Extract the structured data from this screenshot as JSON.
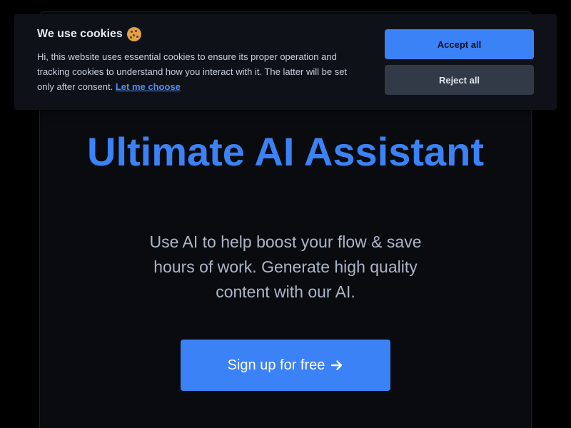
{
  "colors": {
    "background": "#000000",
    "card": "#0a0b0f",
    "accent": "#3b82f6",
    "subtitle": "#aab6c8",
    "banner": "#0e1118",
    "reject_button": "#323a48"
  },
  "cookie_banner": {
    "title": "We use cookies",
    "icon": "cookie-icon",
    "text": "Hi, this website uses essential cookies to ensure its proper operation and tracking cookies to understand how you interact with it. The latter will be set only after consent.",
    "link_label": "Let me choose",
    "accept_label": "Accept all",
    "reject_label": "Reject all"
  },
  "hero": {
    "title": "Ultimate AI Assistant",
    "subtitle": "Use AI to help boost your flow & save hours of work. Generate high quality content with our AI.",
    "cta_label": "Sign up for free",
    "cta_icon": "arrow-right-icon"
  }
}
